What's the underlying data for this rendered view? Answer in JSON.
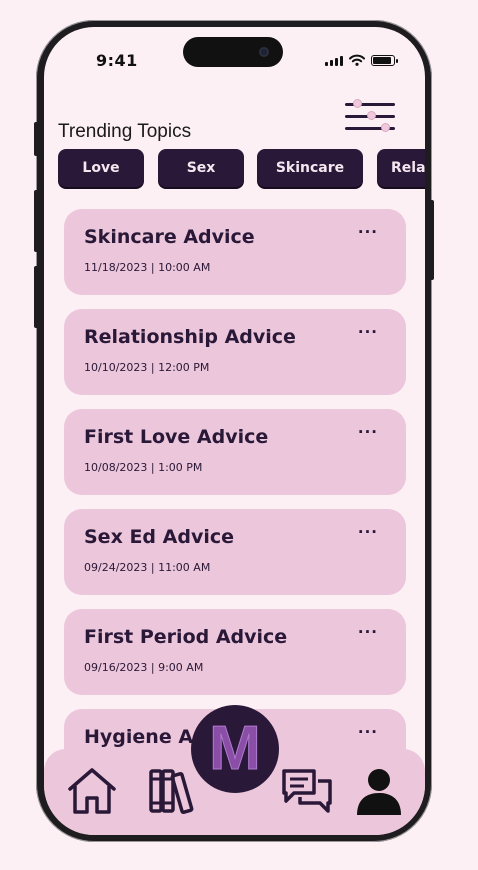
{
  "status_bar": {
    "time": "9:41",
    "battery_level": 0.9
  },
  "header": {
    "title": "Trending Topics",
    "filter_icon": "sliders-icon"
  },
  "topics": [
    {
      "label": "Love"
    },
    {
      "label": "Sex"
    },
    {
      "label": "Skincare"
    },
    {
      "label": "Relationship"
    }
  ],
  "posts": [
    {
      "title": "Skincare Advice",
      "datetime": "11/18/2023 | 10:00 AM",
      "more": "···"
    },
    {
      "title": "Relationship Advice",
      "datetime": "10/10/2023 | 12:00 PM",
      "more": "···"
    },
    {
      "title": "First Love Advice",
      "datetime": "10/08/2023 | 1:00 PM",
      "more": "···"
    },
    {
      "title": "Sex Ed Advice",
      "datetime": "09/24/2023 | 11:00 AM",
      "more": "···"
    },
    {
      "title": "First Period Advice",
      "datetime": "09/16/2023 | 9:00 AM",
      "more": "···"
    },
    {
      "title": "Hygiene Advice",
      "datetime": "",
      "more": "···"
    }
  ],
  "bottom_nav": {
    "items": [
      {
        "icon": "home-icon"
      },
      {
        "icon": "library-icon"
      },
      {
        "icon": "chat-icon"
      },
      {
        "icon": "profile-icon"
      }
    ],
    "center_logo": "M"
  },
  "colors": {
    "background": "#fcf0f4",
    "card": "#ecc6da",
    "accent_dark": "#2a1838",
    "logo_purple": "#8a4ea6"
  }
}
